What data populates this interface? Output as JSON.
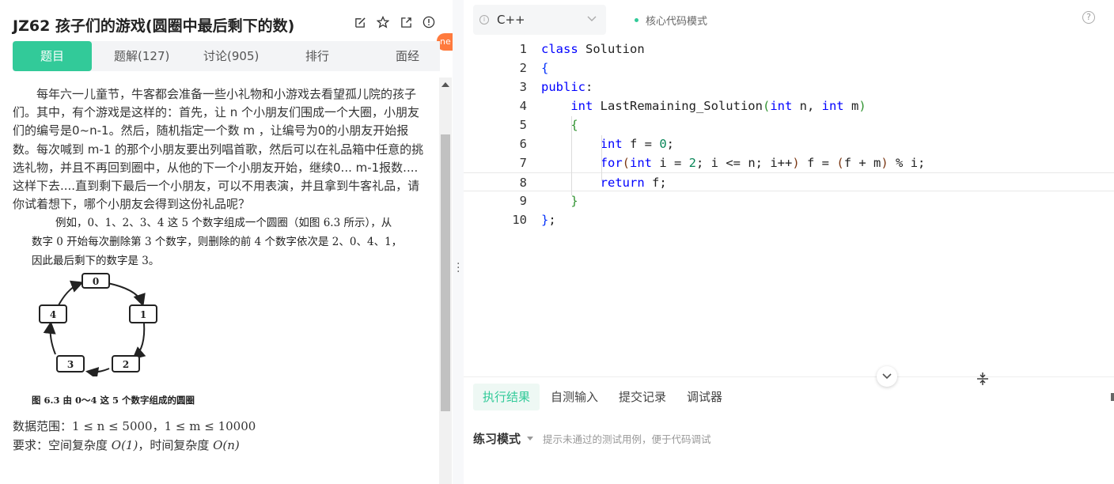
{
  "problem": {
    "title": "JZ62  孩子们的游戏(圆圈中最后剩下的数)",
    "new_badge": "ne",
    "tabs": [
      "题目",
      "题解(127)",
      "讨论(905)",
      "排行",
      "面经"
    ],
    "description": "每年六一儿童节，牛客都会准备一些小礼物和小游戏去看望孤儿院的孩子们。其中，有个游戏是这样的：首先，让 n 个小朋友们围成一个大圈，小朋友们的编号是0~n-1。然后，随机指定一个数 m ，让编号为0的小朋友开始报数。每次喊到 m-1 的那个小朋友要出列唱首歌，然后可以在礼品箱中任意的挑选礼物，并且不再回到圈中，从他的下一个小朋友开始，继续0... m-1报数....这样下去....直到剩下最后一个小朋友，可以不用表演，并且拿到牛客礼品，请你试着想下，哪个小朋友会得到这份礼品呢？",
    "book_line1": "例如，0、1、2、3、4 这 5 个数字组成一个圆圈（如图 6.3 所示），从",
    "book_line2": "数字 0 开始每次删除第 3 个数字，则删除的前 4 个数字依次是 2、0、4、1，",
    "book_line3": "因此最后剩下的数字是 3。",
    "figure_nodes": [
      "0",
      "1",
      "2",
      "3",
      "4"
    ],
    "figure_caption": "图 6.3   由 0～4 这 5 个数字组成的圆圈",
    "range_label": "数据范围：",
    "range_math": "1 ≤ n ≤ 5000，1 ≤ m ≤ 10000",
    "req_label": "要求：空间复杂度 ",
    "req_space": "O(1)",
    "req_mid": "，时间复杂度 ",
    "req_time": "O(n)"
  },
  "editor": {
    "language": "C++",
    "mode": "核心代码模式",
    "help": "?",
    "line_numbers": [
      "1",
      "2",
      "3",
      "4",
      "5",
      "6",
      "7",
      "8",
      "9",
      "10"
    ],
    "current_line": 8
  },
  "bottom": {
    "tabs": [
      "执行结果",
      "自测输入",
      "提交记录",
      "调试器"
    ],
    "practice_label": "练习模式",
    "practice_hint": "提示未通过的测试用例，便于代码调试"
  },
  "icons": [
    "edit-icon",
    "star-icon",
    "share-icon",
    "info-icon",
    "chevron-down-icon",
    "resize-icon",
    "help-icon"
  ],
  "colors": {
    "accent": "#32ca99",
    "keyword": "#0000ff",
    "number": "#098658",
    "new_badge": "#ff7a3d"
  }
}
